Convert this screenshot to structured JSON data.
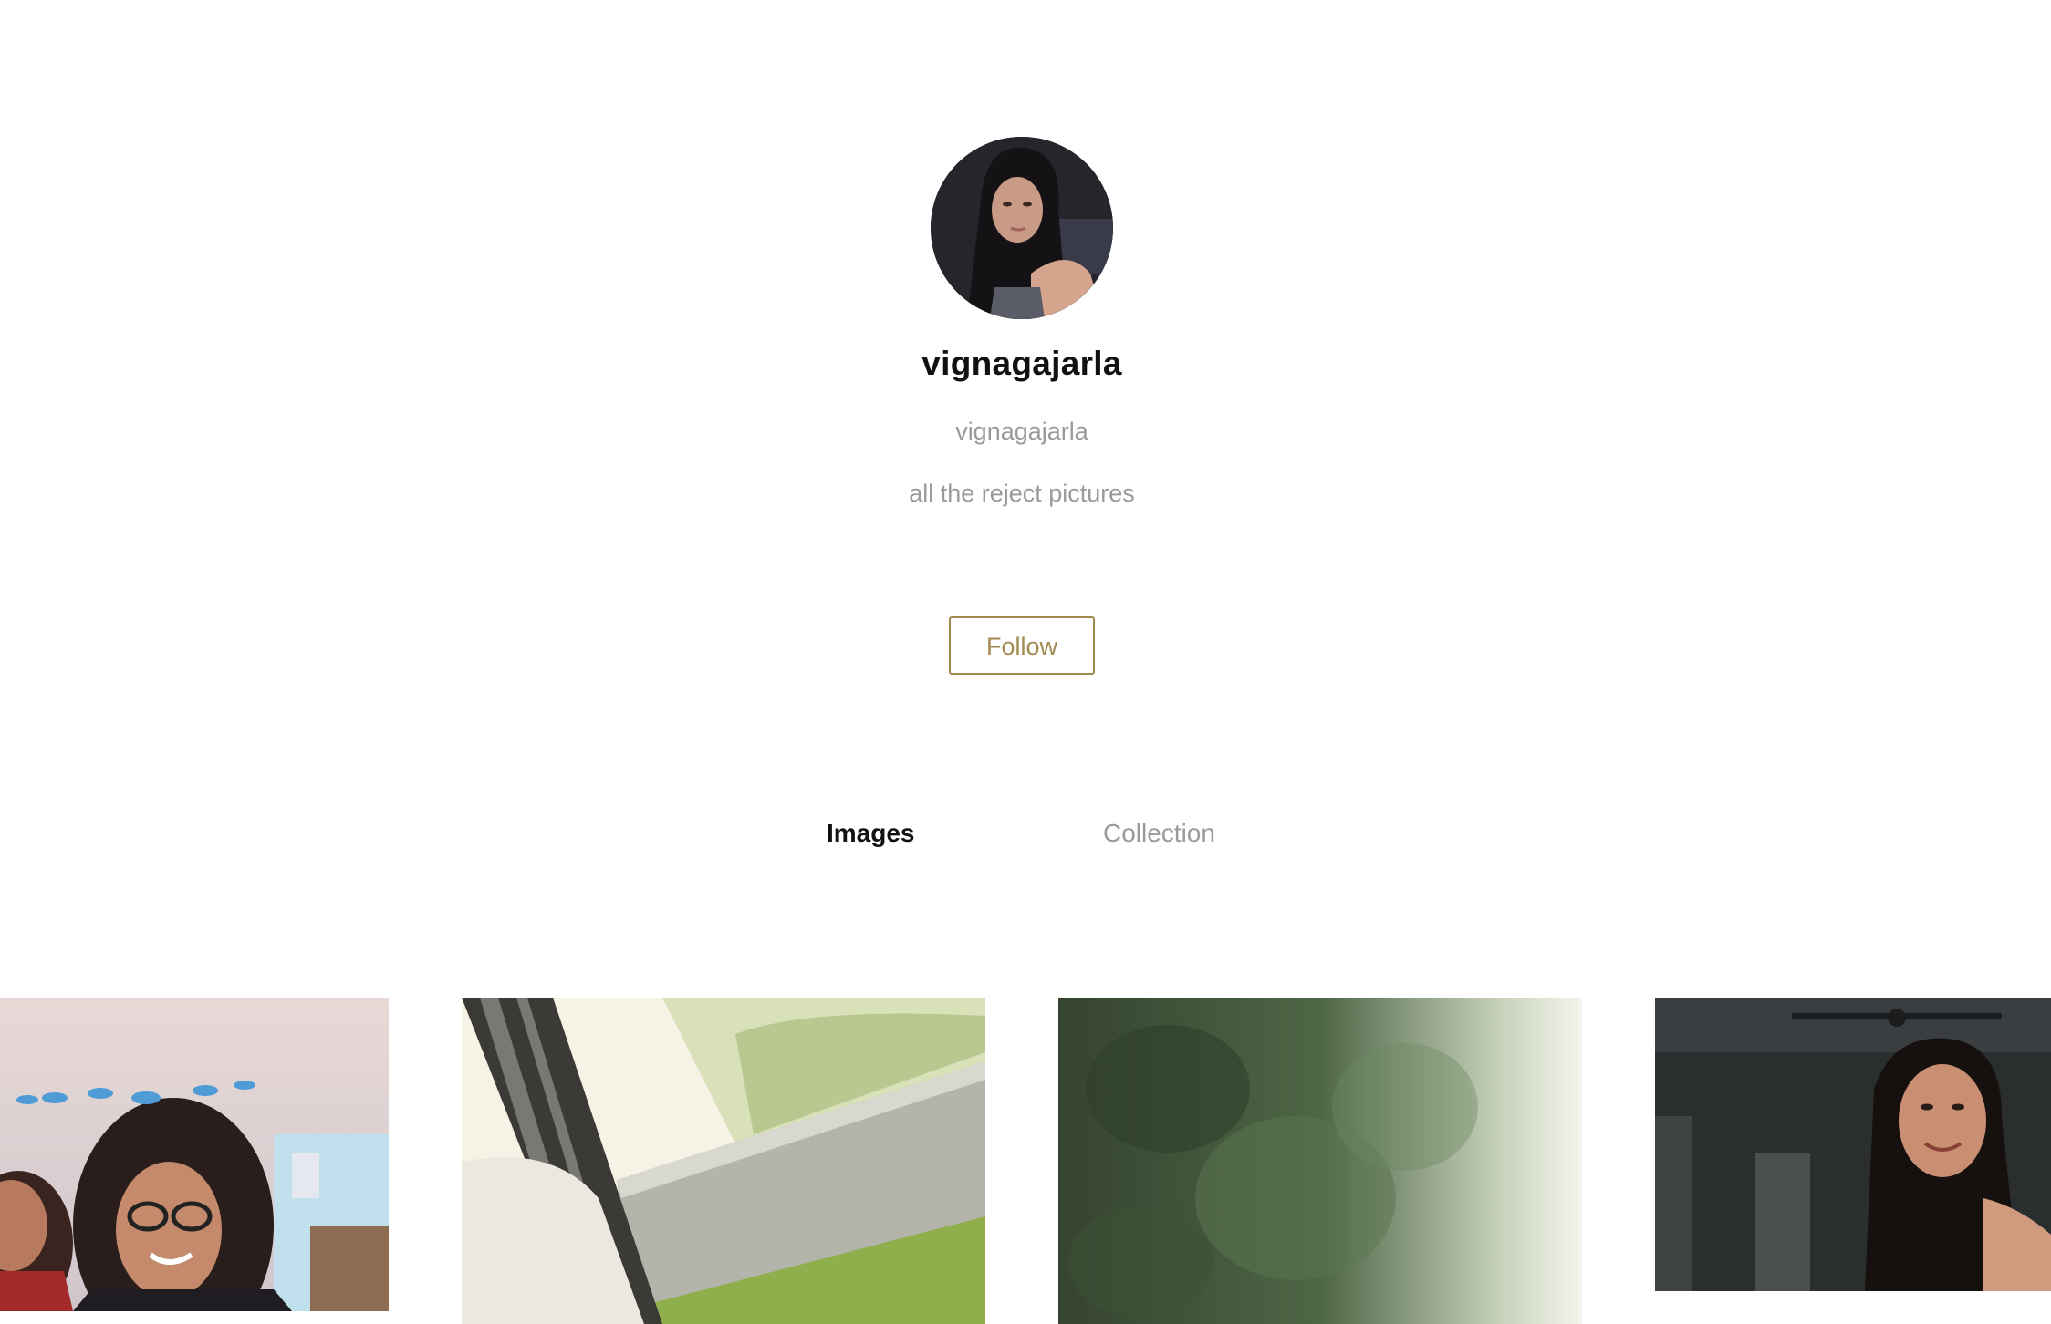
{
  "profile": {
    "display_name": "vignagajarla",
    "username": "vignagajarla",
    "bio": "all the reject pictures",
    "avatar_icon": "profile-photo"
  },
  "actions": {
    "follow_label": "Follow"
  },
  "tabs": [
    {
      "label": "Images",
      "active": true
    },
    {
      "label": "Collection",
      "active": false
    }
  ],
  "colors": {
    "accent": "#a08a4f",
    "text_primary": "#111111",
    "text_secondary": "#9a9a9a",
    "background": "#ffffff"
  },
  "gallery": {
    "photos": [
      {
        "subject": "classroom selfie with bird filter"
      },
      {
        "subject": "blurry window and grass"
      },
      {
        "subject": "blurry green trees"
      },
      {
        "subject": "smiling selfie in dark room"
      }
    ]
  }
}
